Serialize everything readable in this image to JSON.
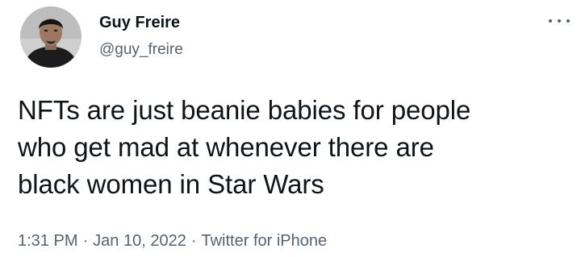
{
  "user": {
    "display_name": "Guy Freire",
    "handle": "@guy_freire"
  },
  "tweet": {
    "text": "NFTs are just beanie babies for people\nwho get mad at whenever there are\nblack women in Star Wars",
    "time": "1:31 PM",
    "date": "Jan 10, 2022",
    "source": "Twitter for iPhone",
    "separator": "·"
  },
  "icons": {
    "more": "more-options-icon",
    "avatar": "profile-photo"
  }
}
